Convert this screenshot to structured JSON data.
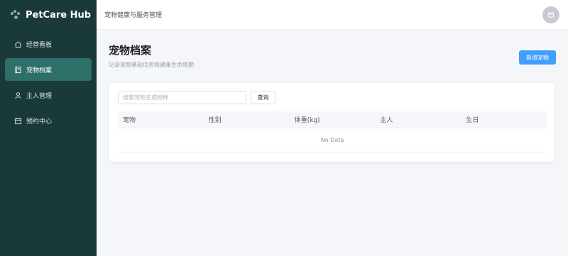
{
  "brand": {
    "title": "PetCare Hub",
    "icon": "paw-icon"
  },
  "sidebar": {
    "items": [
      {
        "label": "经营看板",
        "icon": "home-icon",
        "active": false
      },
      {
        "label": "宠物档案",
        "icon": "book-icon",
        "active": true
      },
      {
        "label": "主人管理",
        "icon": "user-icon",
        "active": false
      },
      {
        "label": "预约中心",
        "icon": "calendar-icon",
        "active": false
      }
    ]
  },
  "header": {
    "title": "宠物健康与服务管理",
    "avatar_icon": "user-avatar-icon"
  },
  "main": {
    "title": "宠物档案",
    "subtitle": "记录宠物基础信息和健康生命周期",
    "add_button": "新增宠物",
    "search": {
      "placeholder": "搜索宠物名或物种",
      "value": "",
      "button": "查询"
    },
    "table": {
      "columns": [
        "宠物",
        "性别",
        "体重(kg)",
        "主人",
        "生日"
      ],
      "rows": [],
      "empty_text": "No Data"
    }
  },
  "colors": {
    "sidebar_bg": "#1a3a3a",
    "active_item": "#2f6f69",
    "primary": "#409eff",
    "page_bg": "#f4f6f9"
  }
}
